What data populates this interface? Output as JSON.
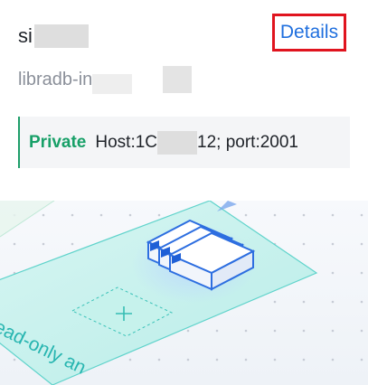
{
  "header": {
    "name_prefix": "si",
    "details_label": "Details"
  },
  "subtitle": {
    "prefix": "libradb-in"
  },
  "endpoint": {
    "type": "Private",
    "host_prefix": "Host:1C",
    "host_suffix": "12; port:2001"
  },
  "illustration": {
    "caption": "ead-only an"
  },
  "colors": {
    "accent": "#1f6fde",
    "private": "#18a068",
    "highlight": "#e0141e",
    "teal": "#27b5b0"
  },
  "icons": [
    "database-server-icon",
    "add-node-icon"
  ]
}
